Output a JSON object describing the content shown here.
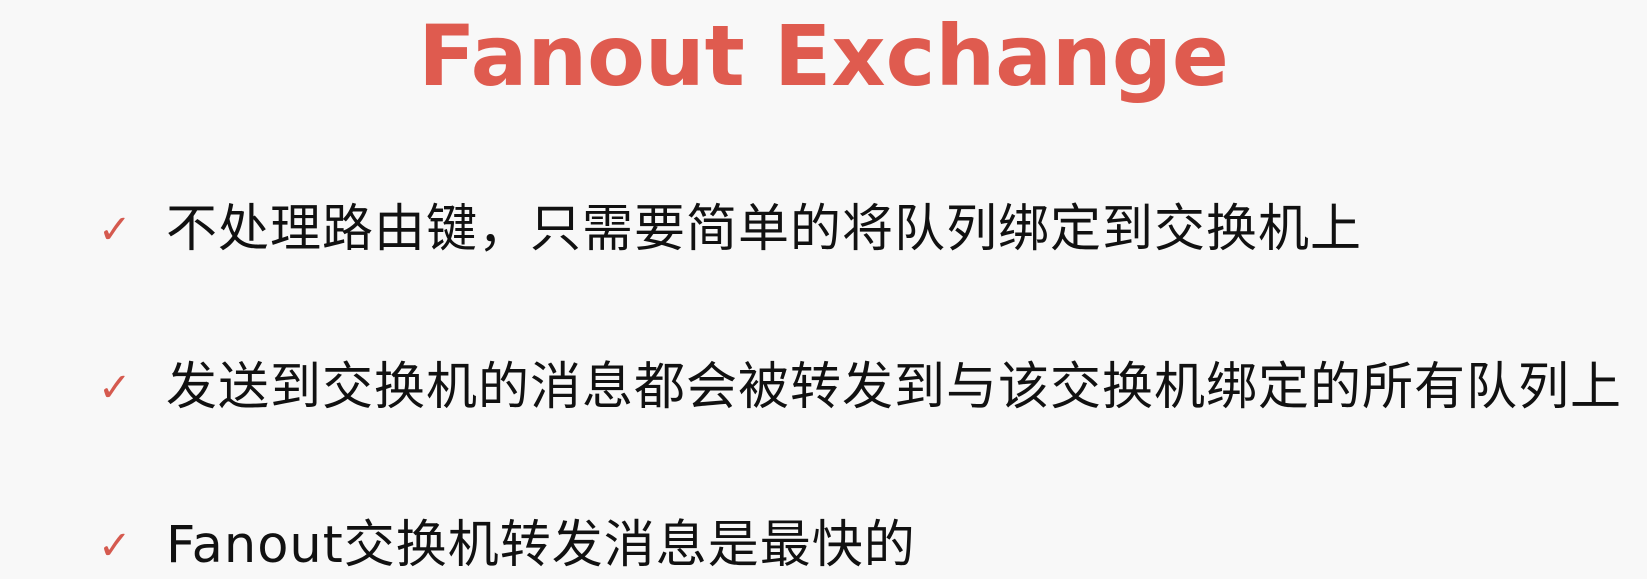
{
  "slide": {
    "title": "Fanout Exchange",
    "bullets": [
      {
        "icon": "check-icon",
        "text": "不处理路由键，只需要简单的将队列绑定到交换机上"
      },
      {
        "icon": "check-icon",
        "text": "发送到交换机的消息都会被转发到与该交换机绑定的所有队列上"
      },
      {
        "icon": "check-icon",
        "text": "Fanout交换机转发消息是最快的"
      }
    ]
  },
  "colors": {
    "title": "#df5b4f",
    "check": "#d55a4f",
    "text": "#111111",
    "background": "#f8f8f8"
  }
}
